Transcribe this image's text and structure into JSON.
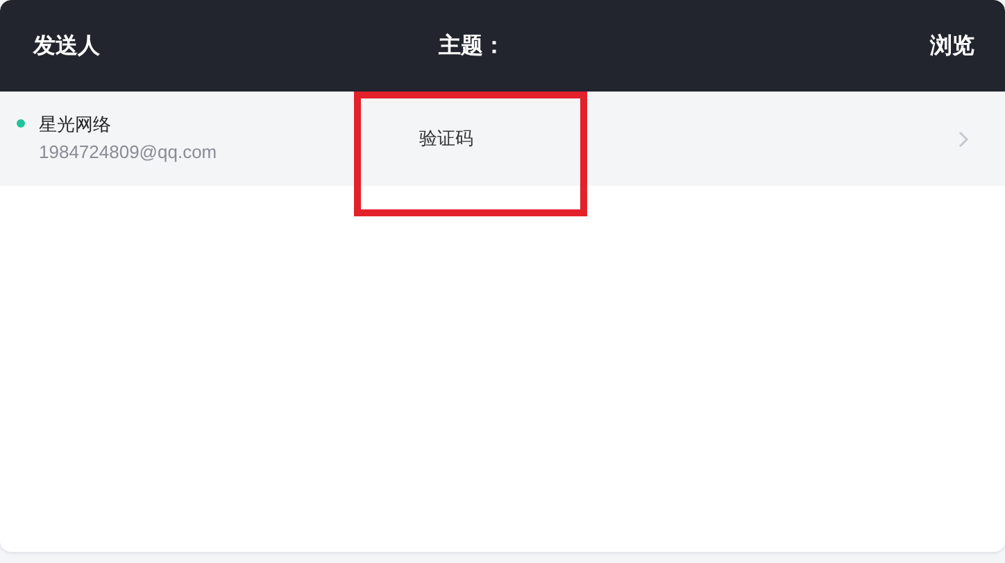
{
  "table": {
    "columns": [
      {
        "label": "发送人"
      },
      {
        "label": "主题："
      },
      {
        "label": "浏览"
      }
    ],
    "rows": [
      {
        "sender_name": "星光网络",
        "sender_email": "1984724809@qq.com",
        "subject": "验证码",
        "unread": true,
        "color": "#1fc39a"
      }
    ]
  }
}
